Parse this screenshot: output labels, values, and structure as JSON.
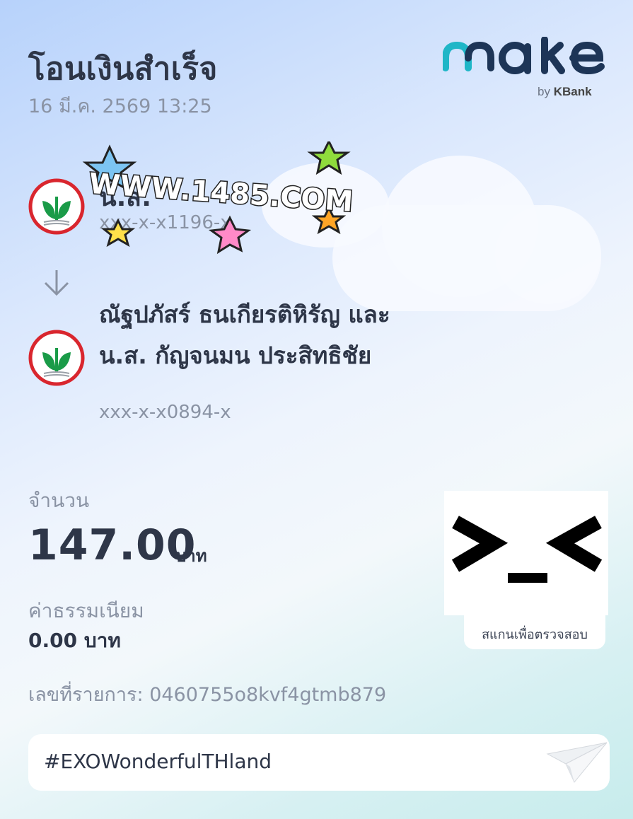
{
  "header": {
    "title": "โอนเงินสำเร็จ",
    "datetime": "16 มี.ค. 2569 13:25"
  },
  "brand": {
    "logo_text": "make",
    "by_text": "by",
    "bank_text": "KBank"
  },
  "sender": {
    "name": "น.ส.",
    "account": "xxx-x-x1196-x",
    "bank_icon": "kbank-logo-icon"
  },
  "sticker": {
    "text": "WWW.1485.COM"
  },
  "receiver": {
    "name": "ณัฐปภัสร์ ธนเกียรติหิรัญ และ น.ส. กัญจนมน ประสิทธิชัย",
    "account": "xxx-x-x0894-x",
    "bank_icon": "kbank-logo-icon"
  },
  "amount": {
    "label": "จำนวน",
    "value": "147.00",
    "unit": "บาท"
  },
  "fee": {
    "label": "ค่าธรรมเนียม",
    "value": "0.00 บาท"
  },
  "reference": {
    "text": "เลขที่รายการ: 0460755o8kvf4gtmb879"
  },
  "qr": {
    "caption": "สแกนเพื่อตรวจสอบ"
  },
  "note": {
    "text": "#EXOWonderfulTHland"
  },
  "colors": {
    "kbank_green": "#1a9b48",
    "kbank_red": "#d9262e",
    "logo_navy": "#1d3557",
    "logo_teal": "#1fb6c7"
  }
}
